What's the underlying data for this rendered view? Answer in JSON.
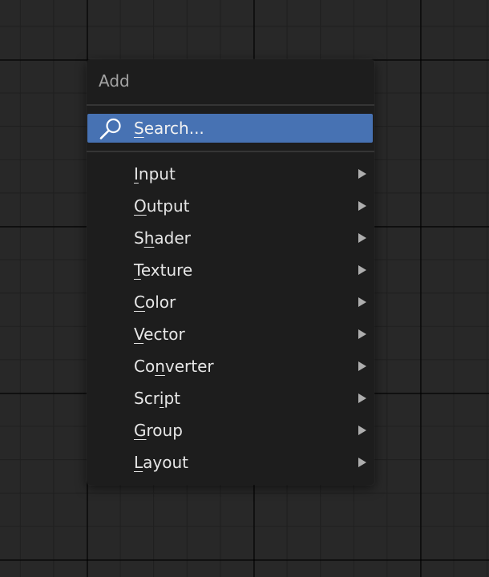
{
  "menu": {
    "title": "Add",
    "search": {
      "label": "Search...",
      "icon": "search-icon",
      "highlight_color": "#4772b3"
    },
    "items": [
      {
        "label": "Input",
        "hotkey_index": 0,
        "has_submenu": true
      },
      {
        "label": "Output",
        "hotkey_index": 0,
        "has_submenu": true
      },
      {
        "label": "Shader",
        "hotkey_index": 1,
        "has_submenu": true
      },
      {
        "label": "Texture",
        "hotkey_index": 0,
        "has_submenu": true
      },
      {
        "label": "Color",
        "hotkey_index": 0,
        "has_submenu": true
      },
      {
        "label": "Vector",
        "hotkey_index": 0,
        "has_submenu": true
      },
      {
        "label": "Converter",
        "hotkey_index": 2,
        "has_submenu": true
      },
      {
        "label": "Script",
        "hotkey_index": 3,
        "has_submenu": true
      },
      {
        "label": "Group",
        "hotkey_index": 0,
        "has_submenu": true
      },
      {
        "label": "Layout",
        "hotkey_index": 0,
        "has_submenu": true
      }
    ]
  },
  "colors": {
    "background": "#282828",
    "menu_background": "#1d1d1d",
    "text": "#e6e6e6",
    "title_text": "#a4a4a4"
  }
}
